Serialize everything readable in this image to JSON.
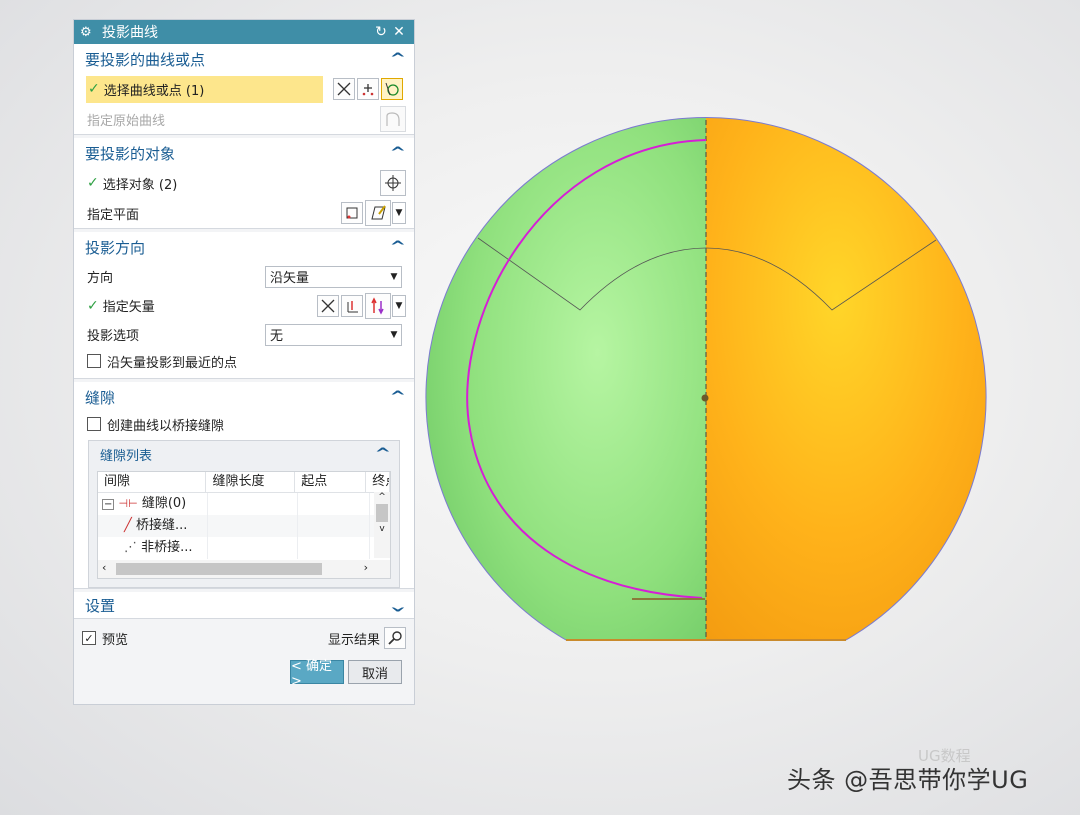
{
  "dialog": {
    "title": "投影曲线",
    "group_curves": {
      "title": "要投影的曲线或点",
      "select_label": "选择曲线或点 (1)",
      "original_label": "指定原始曲线"
    },
    "group_target": {
      "title": "要投影的对象",
      "select_label": "选择对象 (2)",
      "plane_label": "指定平面"
    },
    "group_direction": {
      "title": "投影方向",
      "direction_label": "方向",
      "direction_value": "沿矢量",
      "vector_label": "指定矢量",
      "option_label": "投影选项",
      "option_value": "无",
      "nearest_label": "沿矢量投影到最近的点",
      "nearest_checked": false
    },
    "group_gap": {
      "title": "缝隙",
      "bridge_label": "创建曲线以桥接缝隙",
      "bridge_checked": false,
      "list_title": "缝隙列表",
      "columns": [
        "间隙",
        "缝隙长度",
        "起点",
        "终点"
      ],
      "rows": [
        "缝隙(0)",
        "桥接缝...",
        "非桥接..."
      ]
    },
    "group_settings": {
      "title": "设置"
    },
    "preview_label": "预览",
    "preview_checked": true,
    "show_result_label": "显示结果",
    "ok_label": "< 确定 >",
    "cancel_label": "取消"
  },
  "watermark": {
    "text": "头条 @吾思带你学UG",
    "secondary": "UG数程"
  },
  "colors": {
    "title_bar": "#3f8ea7",
    "group_header": "#1a5d93",
    "selection_highlight": "#fde68c",
    "sphere_left": "#8fe07d",
    "sphere_right": "#ffb21a",
    "projected_curve": "#d61ed6"
  }
}
